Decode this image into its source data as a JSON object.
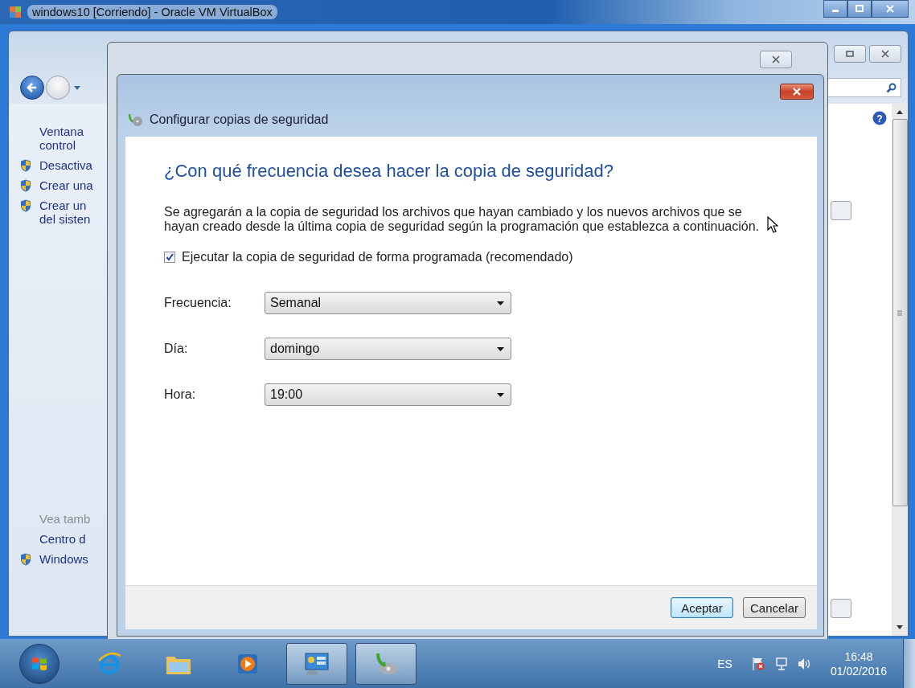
{
  "vm_window": {
    "title": "windows10 [Corriendo] - Oracle VM VirtualBox"
  },
  "control_panel": {
    "help": "?",
    "sidebar": [
      {
        "kind": "link",
        "lines": [
          "Ventana",
          "control"
        ],
        "shield": false
      },
      {
        "kind": "link",
        "lines": [
          "Desactiva"
        ],
        "shield": true
      },
      {
        "kind": "link",
        "lines": [
          "Crear una"
        ],
        "shield": true
      },
      {
        "kind": "link",
        "lines": [
          "Crear un",
          "del sisten"
        ],
        "shield": true
      },
      {
        "kind": "heading",
        "lines": [
          "Vea tamb"
        ],
        "shield": false
      },
      {
        "kind": "link",
        "lines": [
          "Centro d"
        ],
        "shield": false
      },
      {
        "kind": "link",
        "lines": [
          "Windows"
        ],
        "shield": true
      }
    ]
  },
  "dialog": {
    "title": "Configurar copias de seguridad",
    "heading": "¿Con qué frecuencia desea hacer la copia de seguridad?",
    "description": "Se agregarán a la copia de seguridad los archivos que hayan cambiado y los nuevos archivos que se hayan creado desde la última copia de seguridad según la programación que establezca a continuación.",
    "schedule_checkbox": {
      "label": "Ejecutar la copia de seguridad de forma programada (recomendado)",
      "checked": true
    },
    "fields": [
      {
        "label": "Frecuencia:",
        "value": "Semanal"
      },
      {
        "label": "Día:",
        "value": "domingo"
      },
      {
        "label": "Hora:",
        "value": "19:00"
      }
    ],
    "buttons": [
      {
        "label": "Aceptar",
        "default": true
      },
      {
        "label": "Cancelar",
        "default": false
      }
    ]
  },
  "taskbar": {
    "apps": [
      {
        "kind": "browser",
        "active": false
      },
      {
        "kind": "folder",
        "active": false
      },
      {
        "kind": "media",
        "active": false
      },
      {
        "kind": "panel",
        "active": true
      },
      {
        "kind": "backup",
        "active": true
      }
    ],
    "language": "ES",
    "time": "16:48",
    "date": "01/02/2016"
  }
}
